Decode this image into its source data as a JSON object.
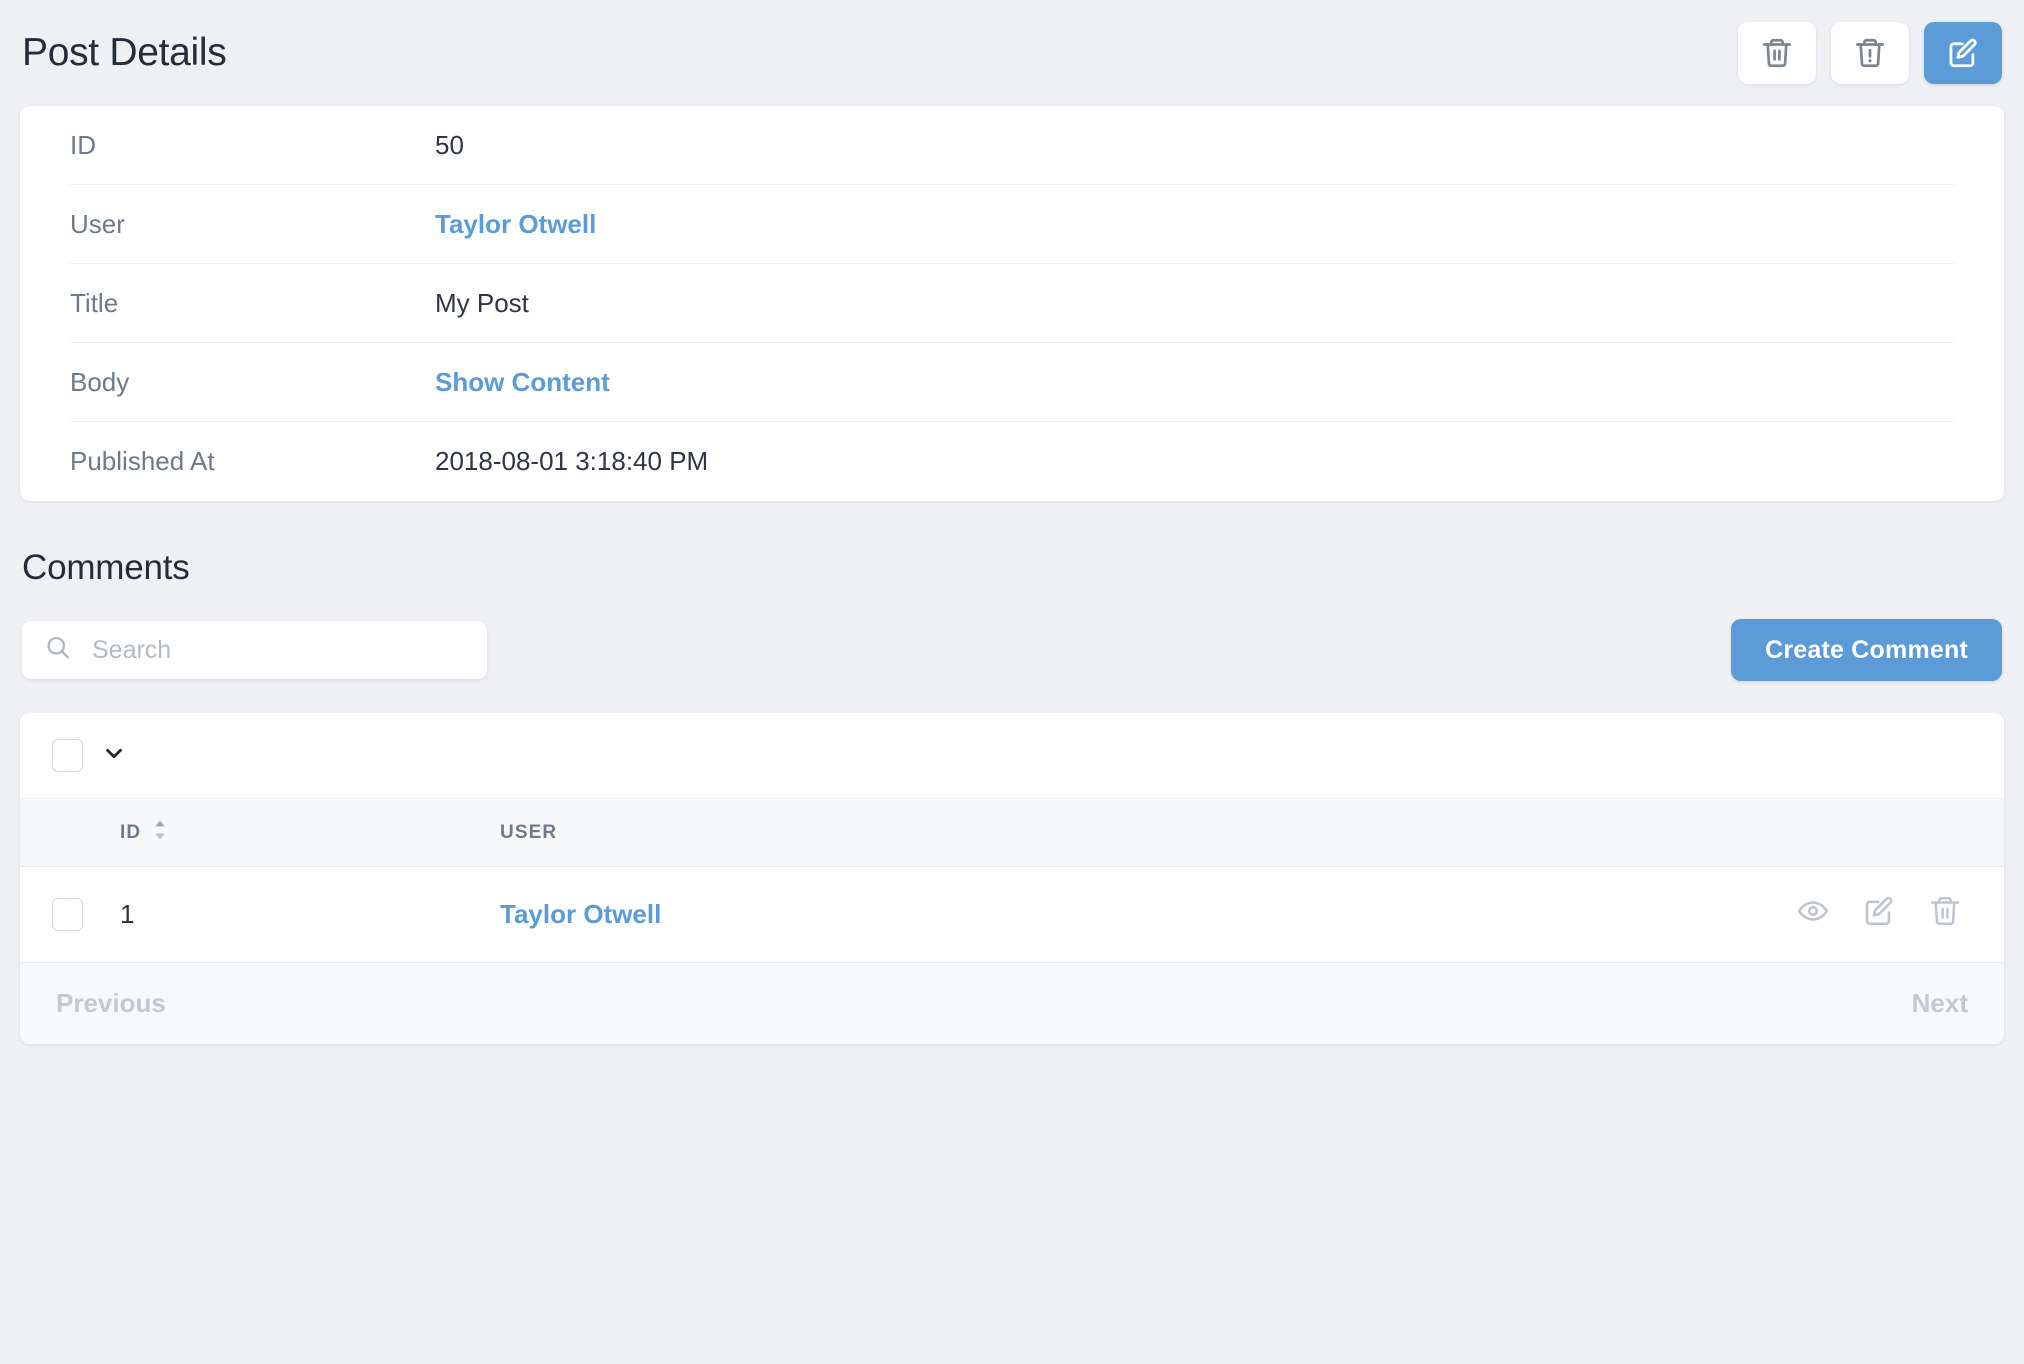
{
  "header": {
    "title": "Post Details",
    "actions": [
      {
        "name": "delete-button",
        "icon": "trash-icon",
        "style": "default"
      },
      {
        "name": "force-delete-button",
        "icon": "trash-alert-icon",
        "style": "default"
      },
      {
        "name": "edit-button",
        "icon": "edit-square-icon",
        "style": "primary"
      }
    ]
  },
  "detail": {
    "fields": [
      {
        "label": "ID",
        "value": "50",
        "type": "text"
      },
      {
        "label": "User",
        "value": "Taylor Otwell",
        "type": "link"
      },
      {
        "label": "Title",
        "value": "My Post",
        "type": "text"
      },
      {
        "label": "Body",
        "value": "Show Content",
        "type": "link"
      },
      {
        "label": "Published At",
        "value": "2018-08-01 3:18:40 PM",
        "type": "text"
      }
    ]
  },
  "comments": {
    "section_title": "Comments",
    "search": {
      "placeholder": "Search",
      "value": ""
    },
    "create_label": "Create Comment",
    "columns": {
      "id": "ID",
      "user": "USER"
    },
    "rows": [
      {
        "id": "1",
        "user": "Taylor Otwell",
        "actions": [
          "eye-icon",
          "edit-square-icon",
          "trash-icon"
        ]
      }
    ],
    "pagination": {
      "previous": "Previous",
      "next": "Next",
      "previous_disabled": true,
      "next_disabled": true
    }
  },
  "colors": {
    "accent": "#5a9bd8",
    "page_bg": "#eef0f4",
    "card_bg": "#ffffff",
    "text": "#252d3c",
    "muted": "#6e7a8a",
    "disabled": "#c3c8d1"
  }
}
